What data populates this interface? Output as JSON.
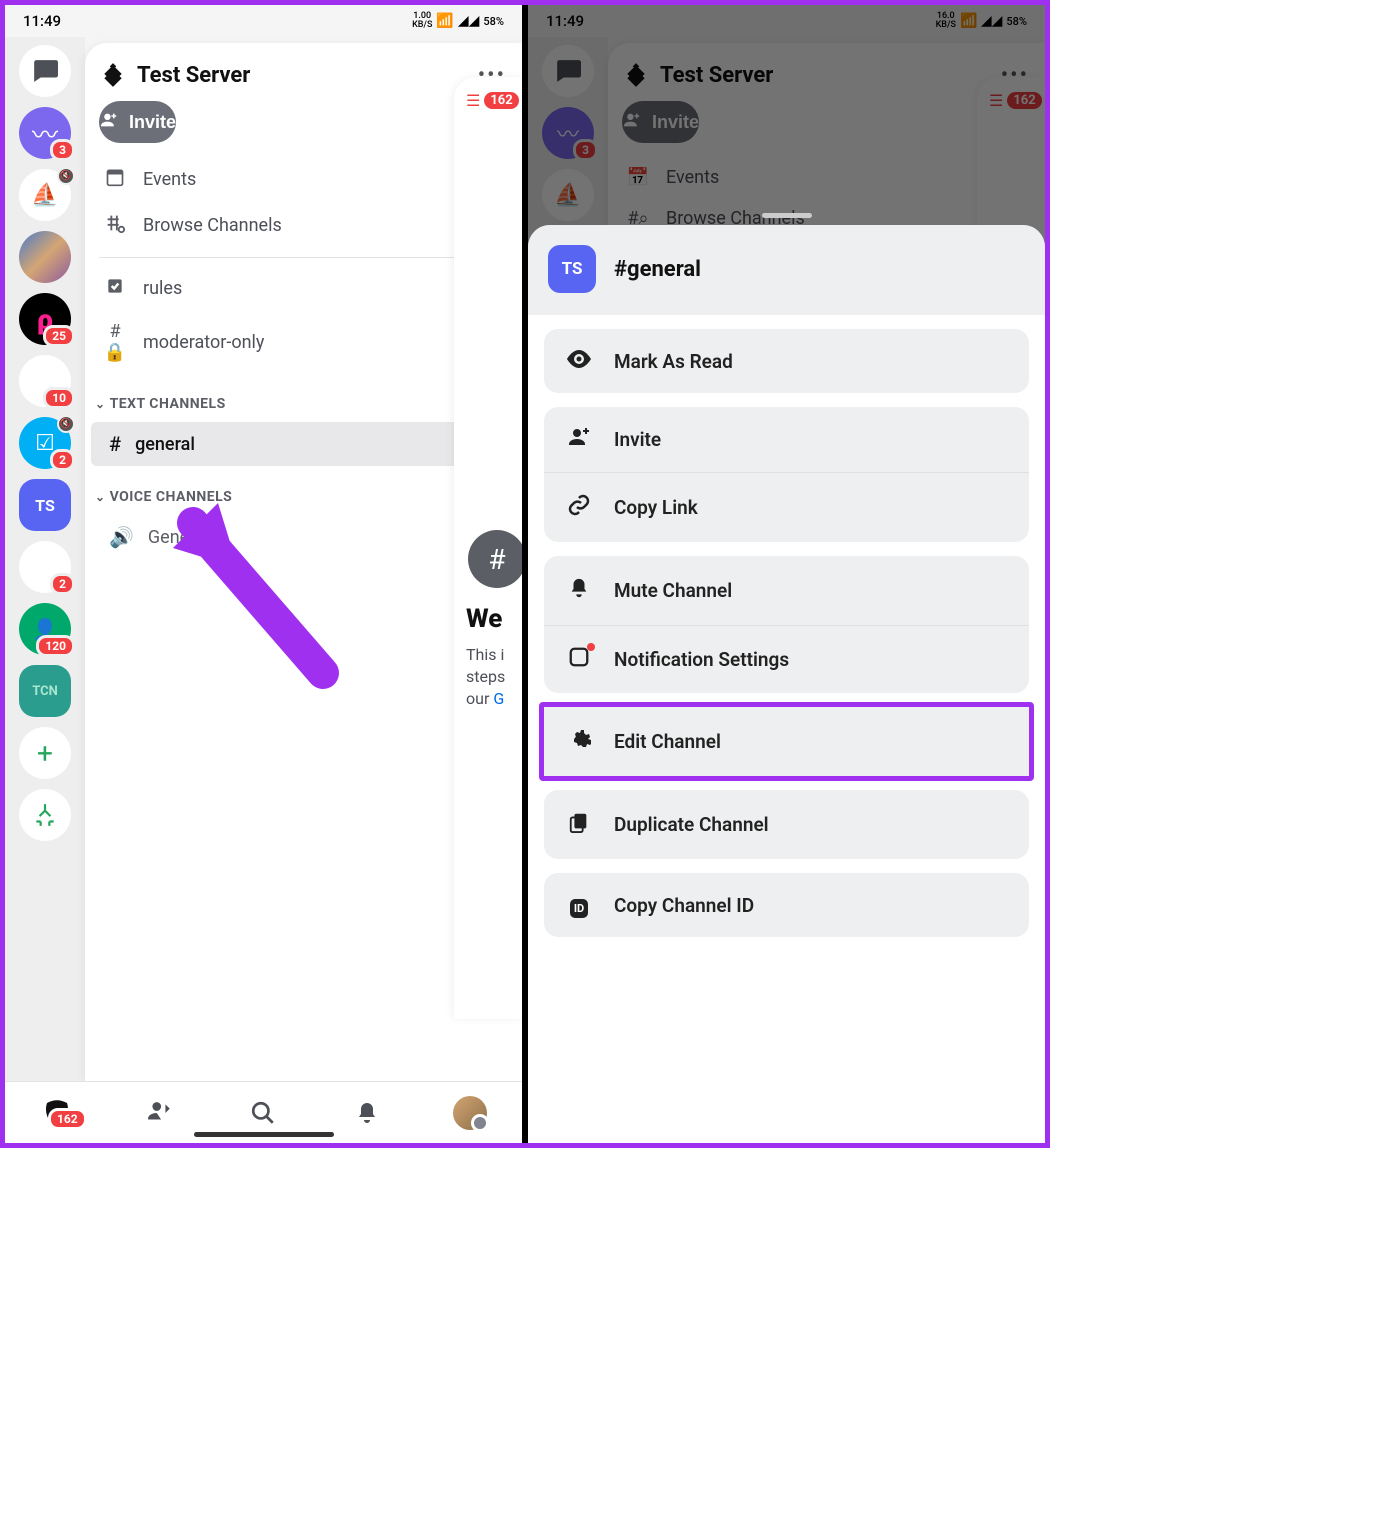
{
  "status": {
    "time": "11:49",
    "net_speed_1": "1.00",
    "net_speed_2": "16.0",
    "net_unit": "KB/S",
    "battery": "58%"
  },
  "server": {
    "name": "Test Server",
    "initials": "TS",
    "invite_label": "Invite",
    "events_label": "Events",
    "browse_label": "Browse Channels",
    "pinned": [
      {
        "icon": "rules",
        "label": "rules"
      },
      {
        "icon": "lock",
        "label": "moderator-only"
      }
    ],
    "categories": [
      {
        "name": "TEXT CHANNELS",
        "channels": [
          {
            "icon": "#",
            "label": "general",
            "active": true
          }
        ]
      },
      {
        "name": "VOICE CHANNELS",
        "channels": [
          {
            "icon": "vol",
            "label": "General"
          }
        ]
      }
    ]
  },
  "rail_badges": {
    "wave": "3",
    "pink": "25",
    "empty": "10",
    "check": "2",
    "green": "120",
    "empty2": "2"
  },
  "peek": {
    "badge": "162",
    "title": "We",
    "line1": "This i",
    "line2": "steps",
    "line3_prefix": "our ",
    "line3_link": "G"
  },
  "bottom_nav_badge": "162",
  "sheet": {
    "avatar": "TS",
    "title": "#general",
    "actions": {
      "mark_read": "Mark As Read",
      "invite": "Invite",
      "copy_link": "Copy Link",
      "mute": "Mute Channel",
      "notifications": "Notification Settings",
      "edit": "Edit Channel",
      "duplicate": "Duplicate Channel",
      "copy_id": "Copy Channel ID"
    }
  }
}
